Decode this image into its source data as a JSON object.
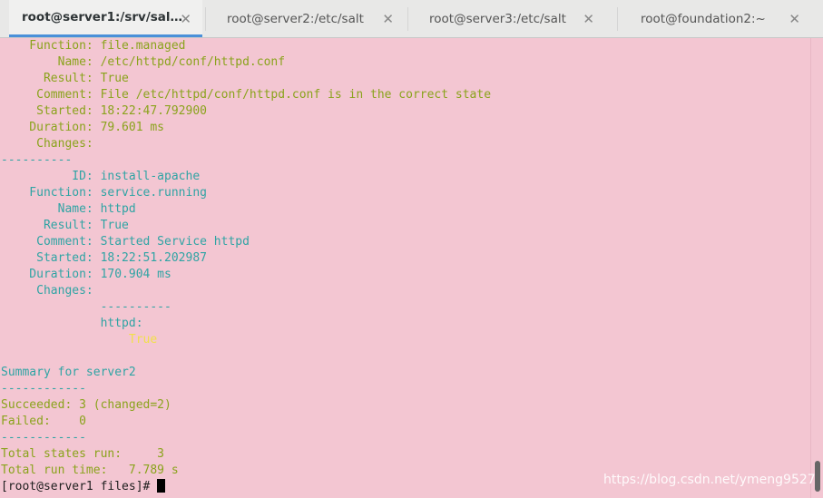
{
  "tabs": [
    {
      "title": "root@server1:/srv/sal…",
      "close": "✕",
      "active": true
    },
    {
      "title": "root@server2:/etc/salt",
      "close": "✕",
      "active": false
    },
    {
      "title": "root@server3:/etc/salt",
      "close": "✕",
      "active": false
    },
    {
      "title": "root@foundation2:~",
      "close": "✕",
      "active": false
    }
  ],
  "terminal": {
    "lines": [
      "    Function: file.managed",
      "        Name: /etc/httpd/conf/httpd.conf",
      "      Result: True",
      "     Comment: File /etc/httpd/conf/httpd.conf is in the correct state",
      "     Started: 18:22:47.792900",
      "    Duration: 79.601 ms",
      "     Changes:   ",
      "----------",
      "          ID: install-apache",
      "    Function: service.running",
      "        Name: httpd",
      "      Result: True",
      "     Comment: Started Service httpd",
      "     Started: 18:22:51.202987",
      "    Duration: 170.904 ms",
      "     Changes:   ",
      "              ----------",
      "              httpd:",
      "                  True",
      "",
      "Summary for server2",
      "------------",
      "Succeeded: 3 (changed=2)",
      "Failed:    0",
      "------------",
      "Total states run:     3",
      "Total run time:   7.789 s",
      "[root@server1 files]# "
    ]
  },
  "watermark": "https://blog.csdn.net/ymeng9527"
}
